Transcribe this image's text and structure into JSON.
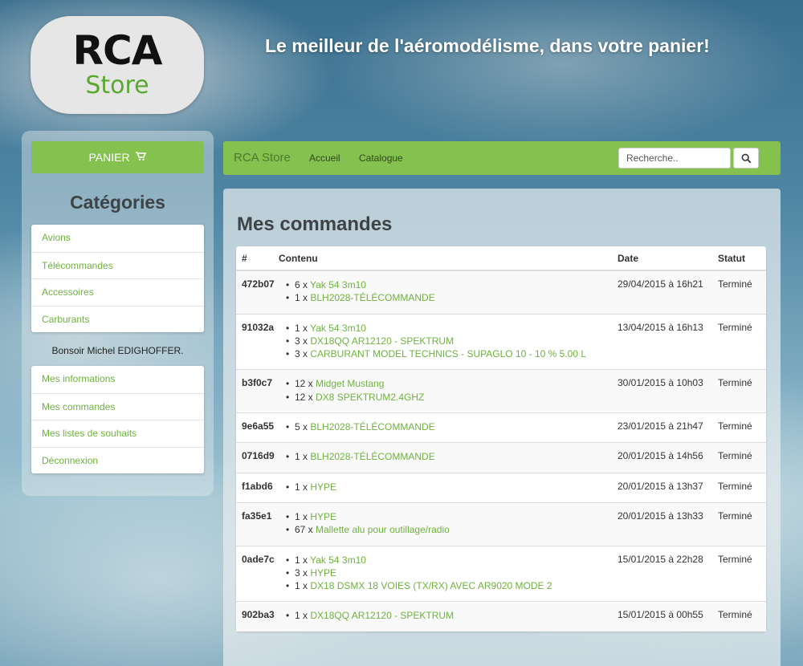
{
  "logo": {
    "line1": "RCA",
    "line2": "Store"
  },
  "tagline": "Le meilleur de l'aéromodélisme, dans votre panier!",
  "sidebar": {
    "cart_label": "PANIER",
    "categories_title": "Catégories",
    "categories": [
      {
        "label": "Avions"
      },
      {
        "label": "Télécommandes"
      },
      {
        "label": "Accessoires"
      },
      {
        "label": "Carburants"
      }
    ],
    "greeting": "Bonsoir Michel EDIGHOFFER.",
    "account_links": [
      {
        "label": "Mes informations"
      },
      {
        "label": "Mes commandes"
      },
      {
        "label": "Mes listes de souhaits"
      },
      {
        "label": "Déconnexion"
      }
    ]
  },
  "navbar": {
    "brand": "RCA Store",
    "links": [
      {
        "label": "Accueil"
      },
      {
        "label": "Catalogue"
      }
    ],
    "search_placeholder": "Recherche.."
  },
  "main": {
    "title": "Mes commandes",
    "columns": [
      "#",
      "Contenu",
      "Date",
      "Statut"
    ],
    "orders": [
      {
        "id": "472b07",
        "date": "29/04/2015 à 16h21",
        "status": "Terminé",
        "items": [
          {
            "qty": "6 x ",
            "name": "Yak 54 3m10"
          },
          {
            "qty": "1 x ",
            "name": "BLH2028-TÉLÉCOMMANDE"
          }
        ]
      },
      {
        "id": "91032a",
        "date": "13/04/2015 à 16h13",
        "status": "Terminé",
        "items": [
          {
            "qty": "1 x ",
            "name": "Yak 54 3m10"
          },
          {
            "qty": "3 x ",
            "name": "DX18QQ AR12120 - SPEKTRUM"
          },
          {
            "qty": "3 x ",
            "name": "CARBURANT MODEL TECHNICS - SUPAGLO 10 - 10 % 5.00 L"
          }
        ]
      },
      {
        "id": "b3f0c7",
        "date": "30/01/2015 à 10h03",
        "status": "Terminé",
        "items": [
          {
            "qty": "12 x ",
            "name": "Midget Mustang"
          },
          {
            "qty": "12 x ",
            "name": "DX8 SPEKTRUM2.4GHZ"
          }
        ]
      },
      {
        "id": "9e6a55",
        "date": "23/01/2015 à 21h47",
        "status": "Terminé",
        "items": [
          {
            "qty": "5 x ",
            "name": "BLH2028-TÉLÉCOMMANDE"
          }
        ]
      },
      {
        "id": "0716d9",
        "date": "20/01/2015 à 14h56",
        "status": "Terminé",
        "items": [
          {
            "qty": "1 x ",
            "name": "BLH2028-TÉLÉCOMMANDE"
          }
        ]
      },
      {
        "id": "f1abd6",
        "date": "20/01/2015 à 13h37",
        "status": "Terminé",
        "items": [
          {
            "qty": "1 x ",
            "name": "HYPE"
          }
        ]
      },
      {
        "id": "fa35e1",
        "date": "20/01/2015 à 13h33",
        "status": "Terminé",
        "items": [
          {
            "qty": "1 x ",
            "name": "HYPE"
          },
          {
            "qty": "67 x ",
            "name": "Mallette alu pour outillage/radio"
          }
        ]
      },
      {
        "id": "0ade7c",
        "date": "15/01/2015 à 22h28",
        "status": "Terminé",
        "items": [
          {
            "qty": "1 x ",
            "name": "Yak 54 3m10"
          },
          {
            "qty": "3 x ",
            "name": "HYPE"
          },
          {
            "qty": "1 x ",
            "name": "DX18 DSMX 18 VOIES (TX/RX) AVEC AR9020 MODE 2"
          }
        ]
      },
      {
        "id": "902ba3",
        "date": "15/01/2015 à 00h55",
        "status": "Terminé",
        "items": [
          {
            "qty": "1 x ",
            "name": "DX18QQ AR12120 - SPEKTRUM"
          }
        ]
      }
    ]
  },
  "colors": {
    "accent": "#84c14e",
    "link": "#6fb23e"
  },
  "icons": {
    "cart": "shopping-cart-icon",
    "search": "search-icon"
  }
}
